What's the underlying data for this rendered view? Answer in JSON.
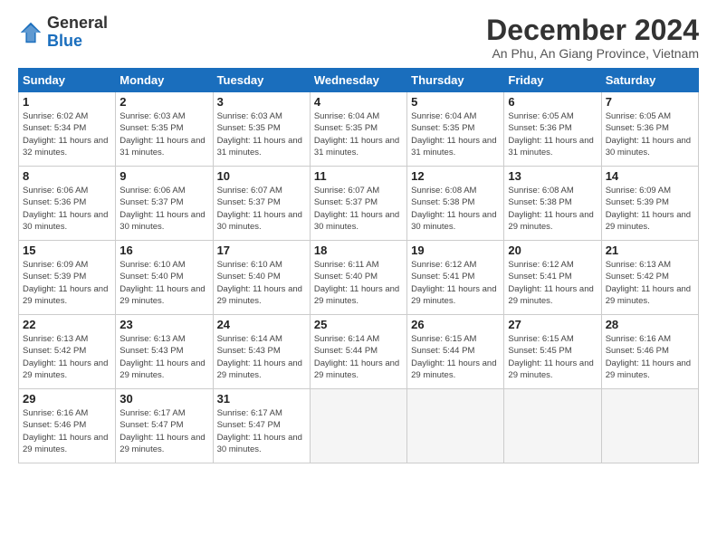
{
  "logo": {
    "general": "General",
    "blue": "Blue"
  },
  "title": "December 2024",
  "location": "An Phu, An Giang Province, Vietnam",
  "days_of_week": [
    "Sunday",
    "Monday",
    "Tuesday",
    "Wednesday",
    "Thursday",
    "Friday",
    "Saturday"
  ],
  "weeks": [
    [
      {
        "day": "1",
        "sunrise": "6:02 AM",
        "sunset": "5:34 PM",
        "daylight": "11 hours and 32 minutes."
      },
      {
        "day": "2",
        "sunrise": "6:03 AM",
        "sunset": "5:35 PM",
        "daylight": "11 hours and 31 minutes."
      },
      {
        "day": "3",
        "sunrise": "6:03 AM",
        "sunset": "5:35 PM",
        "daylight": "11 hours and 31 minutes."
      },
      {
        "day": "4",
        "sunrise": "6:04 AM",
        "sunset": "5:35 PM",
        "daylight": "11 hours and 31 minutes."
      },
      {
        "day": "5",
        "sunrise": "6:04 AM",
        "sunset": "5:35 PM",
        "daylight": "11 hours and 31 minutes."
      },
      {
        "day": "6",
        "sunrise": "6:05 AM",
        "sunset": "5:36 PM",
        "daylight": "11 hours and 31 minutes."
      },
      {
        "day": "7",
        "sunrise": "6:05 AM",
        "sunset": "5:36 PM",
        "daylight": "11 hours and 30 minutes."
      }
    ],
    [
      {
        "day": "8",
        "sunrise": "6:06 AM",
        "sunset": "5:36 PM",
        "daylight": "11 hours and 30 minutes."
      },
      {
        "day": "9",
        "sunrise": "6:06 AM",
        "sunset": "5:37 PM",
        "daylight": "11 hours and 30 minutes."
      },
      {
        "day": "10",
        "sunrise": "6:07 AM",
        "sunset": "5:37 PM",
        "daylight": "11 hours and 30 minutes."
      },
      {
        "day": "11",
        "sunrise": "6:07 AM",
        "sunset": "5:37 PM",
        "daylight": "11 hours and 30 minutes."
      },
      {
        "day": "12",
        "sunrise": "6:08 AM",
        "sunset": "5:38 PM",
        "daylight": "11 hours and 30 minutes."
      },
      {
        "day": "13",
        "sunrise": "6:08 AM",
        "sunset": "5:38 PM",
        "daylight": "11 hours and 29 minutes."
      },
      {
        "day": "14",
        "sunrise": "6:09 AM",
        "sunset": "5:39 PM",
        "daylight": "11 hours and 29 minutes."
      }
    ],
    [
      {
        "day": "15",
        "sunrise": "6:09 AM",
        "sunset": "5:39 PM",
        "daylight": "11 hours and 29 minutes."
      },
      {
        "day": "16",
        "sunrise": "6:10 AM",
        "sunset": "5:40 PM",
        "daylight": "11 hours and 29 minutes."
      },
      {
        "day": "17",
        "sunrise": "6:10 AM",
        "sunset": "5:40 PM",
        "daylight": "11 hours and 29 minutes."
      },
      {
        "day": "18",
        "sunrise": "6:11 AM",
        "sunset": "5:40 PM",
        "daylight": "11 hours and 29 minutes."
      },
      {
        "day": "19",
        "sunrise": "6:12 AM",
        "sunset": "5:41 PM",
        "daylight": "11 hours and 29 minutes."
      },
      {
        "day": "20",
        "sunrise": "6:12 AM",
        "sunset": "5:41 PM",
        "daylight": "11 hours and 29 minutes."
      },
      {
        "day": "21",
        "sunrise": "6:13 AM",
        "sunset": "5:42 PM",
        "daylight": "11 hours and 29 minutes."
      }
    ],
    [
      {
        "day": "22",
        "sunrise": "6:13 AM",
        "sunset": "5:42 PM",
        "daylight": "11 hours and 29 minutes."
      },
      {
        "day": "23",
        "sunrise": "6:13 AM",
        "sunset": "5:43 PM",
        "daylight": "11 hours and 29 minutes."
      },
      {
        "day": "24",
        "sunrise": "6:14 AM",
        "sunset": "5:43 PM",
        "daylight": "11 hours and 29 minutes."
      },
      {
        "day": "25",
        "sunrise": "6:14 AM",
        "sunset": "5:44 PM",
        "daylight": "11 hours and 29 minutes."
      },
      {
        "day": "26",
        "sunrise": "6:15 AM",
        "sunset": "5:44 PM",
        "daylight": "11 hours and 29 minutes."
      },
      {
        "day": "27",
        "sunrise": "6:15 AM",
        "sunset": "5:45 PM",
        "daylight": "11 hours and 29 minutes."
      },
      {
        "day": "28",
        "sunrise": "6:16 AM",
        "sunset": "5:46 PM",
        "daylight": "11 hours and 29 minutes."
      }
    ],
    [
      {
        "day": "29",
        "sunrise": "6:16 AM",
        "sunset": "5:46 PM",
        "daylight": "11 hours and 29 minutes."
      },
      {
        "day": "30",
        "sunrise": "6:17 AM",
        "sunset": "5:47 PM",
        "daylight": "11 hours and 29 minutes."
      },
      {
        "day": "31",
        "sunrise": "6:17 AM",
        "sunset": "5:47 PM",
        "daylight": "11 hours and 30 minutes."
      },
      null,
      null,
      null,
      null
    ]
  ]
}
